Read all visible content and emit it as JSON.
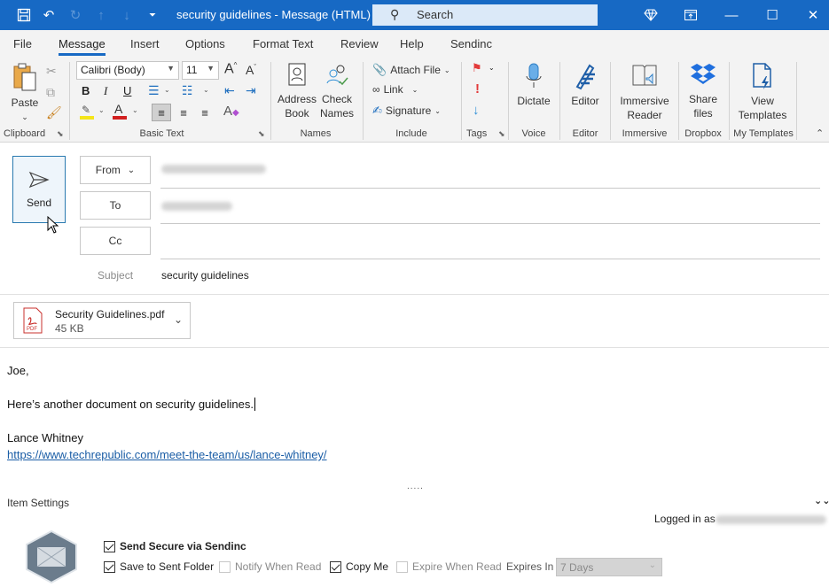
{
  "titlebar": {
    "title": "security guidelines  -  Message (HTML)",
    "search_placeholder": "Search",
    "icons": [
      "save-icon",
      "undo-icon",
      "redo-icon",
      "up-icon",
      "down-icon",
      "customize-qat-icon"
    ],
    "window_controls": [
      "diamond-icon",
      "restore-tab-icon",
      "minimize-icon",
      "maximize-icon",
      "close-icon"
    ]
  },
  "menu": {
    "tabs": [
      "File",
      "Message",
      "Insert",
      "Options",
      "Format Text",
      "Review",
      "Help",
      "Sendinc"
    ],
    "active": "Message"
  },
  "ribbon": {
    "clipboard": {
      "label": "Clipboard",
      "paste": "Paste"
    },
    "basic_text": {
      "label": "Basic Text",
      "font": "Calibri (Body)",
      "size": "11",
      "bold": "B",
      "italic": "I",
      "underline": "U"
    },
    "names": {
      "label": "Names",
      "address_book": [
        "Address",
        "Book"
      ],
      "check_names": [
        "Check",
        "Names"
      ]
    },
    "include": {
      "label": "Include",
      "attach_file": "Attach File",
      "link": "Link",
      "signature": "Signature"
    },
    "tags": {
      "label": "Tags"
    },
    "voice": {
      "label": "Voice",
      "dictate": "Dictate"
    },
    "editor": {
      "label": "Editor",
      "editor": "Editor"
    },
    "immersive": {
      "label": "Immersive",
      "reader": [
        "Immersive",
        "Reader"
      ]
    },
    "dropbox": {
      "label": "Dropbox",
      "share": [
        "Share",
        "files"
      ]
    },
    "templates": {
      "label": "My Templates",
      "view": [
        "View",
        "Templates"
      ]
    },
    "colors": {
      "highlight": "#f5e51a",
      "font_color": "#d21f1f",
      "accent": "#1769c4"
    }
  },
  "compose": {
    "send": "Send",
    "from": "From",
    "to": "To",
    "cc": "Cc",
    "subject_label": "Subject",
    "subject": "security guidelines",
    "attachment": {
      "name": "Security Guidelines.pdf",
      "size": "45 KB",
      "type": "PDF"
    }
  },
  "body": {
    "greeting": "Joe,",
    "line1": "Here’s another document on security guidelines.",
    "signature_name": "Lance Whitney",
    "signature_link": "https://www.techrepublic.com/meet-the-team/us/lance-whitney/"
  },
  "sendinc": {
    "dots": ".....",
    "item_settings": "Item Settings",
    "logged_in": "Logged in as",
    "send_secure": {
      "label": "Send Secure via Sendinc",
      "checked": true
    },
    "options": [
      {
        "label": "Save to Sent Folder",
        "checked": true,
        "enabled": true
      },
      {
        "label": "Notify When Read",
        "checked": false,
        "enabled": false
      },
      {
        "label": "Copy Me",
        "checked": true,
        "enabled": true
      },
      {
        "label": "Expire When Read",
        "checked": false,
        "enabled": false
      }
    ],
    "expires_label": "Expires In",
    "expires_value": "7 Days"
  }
}
